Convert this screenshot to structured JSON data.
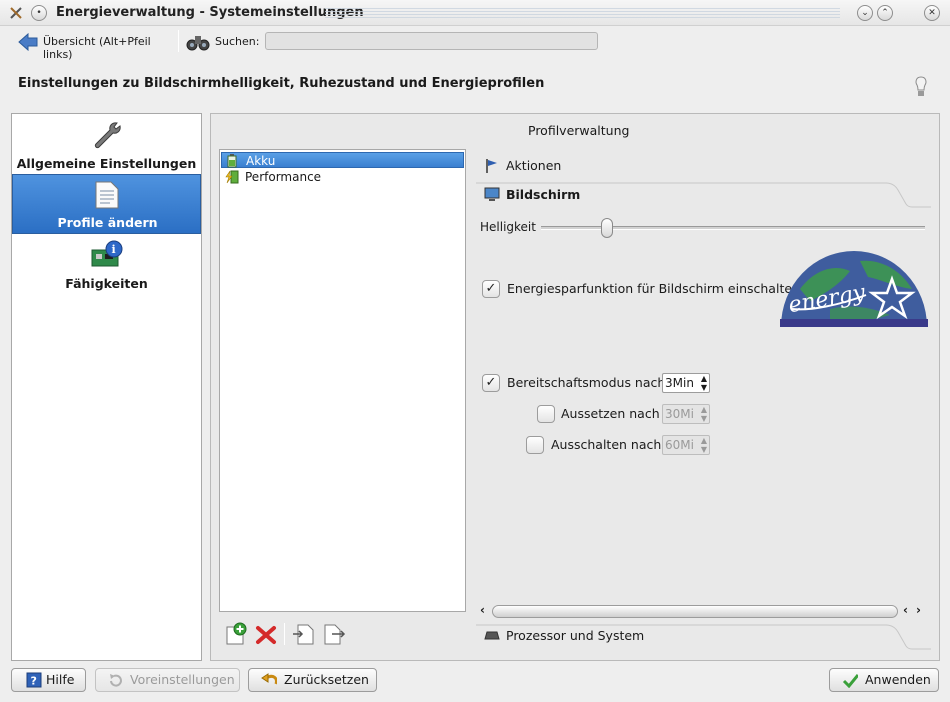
{
  "window": {
    "title": "Energieverwaltung - Systemeinstellungen"
  },
  "toolbar": {
    "back_label": "Übersicht (Alt+Pfeil links)",
    "search_label": "Suchen:",
    "search_value": ""
  },
  "page": {
    "headline": "Einstellungen zu Bildschirmhelligkeit, Ruhezustand und Energieprofilen"
  },
  "sidebar": {
    "items": [
      {
        "label": "Allgemeine Einstellungen",
        "icon": "wrench-icon",
        "selected": false
      },
      {
        "label": "Profile ändern",
        "icon": "document-icon",
        "selected": true
      },
      {
        "label": "Fähigkeiten",
        "icon": "hardware-info-icon",
        "selected": false
      }
    ]
  },
  "profiles": {
    "header": "Profilverwaltung",
    "items": [
      {
        "label": "Akku",
        "selected": true
      },
      {
        "label": "Performance",
        "selected": false
      }
    ]
  },
  "sections": {
    "actions": "Aktionen",
    "display": "Bildschirm",
    "processor": "Prozessor und System"
  },
  "display": {
    "brightness_label": "Helligkeit",
    "brightness_level": 0.16,
    "energy_saving_label": "Energiesparfunktion für Bildschirm einschalten",
    "energy_saving_checked": true,
    "standby_label": "Bereitschaftsmodus nach",
    "standby_checked": true,
    "standby_value": "3Min",
    "suspend_label": "Aussetzen nach",
    "suspend_checked": false,
    "suspend_value": "30Mi",
    "poweroff_label": "Ausschalten nach",
    "poweroff_checked": false,
    "poweroff_value": "60Mi"
  },
  "buttons": {
    "help": "Hilfe",
    "defaults": "Voreinstellungen",
    "reset": "Zurücksetzen",
    "apply": "Anwenden"
  },
  "colors": {
    "selection": "#3a7fd0",
    "window_bg": "#eeeeee"
  }
}
